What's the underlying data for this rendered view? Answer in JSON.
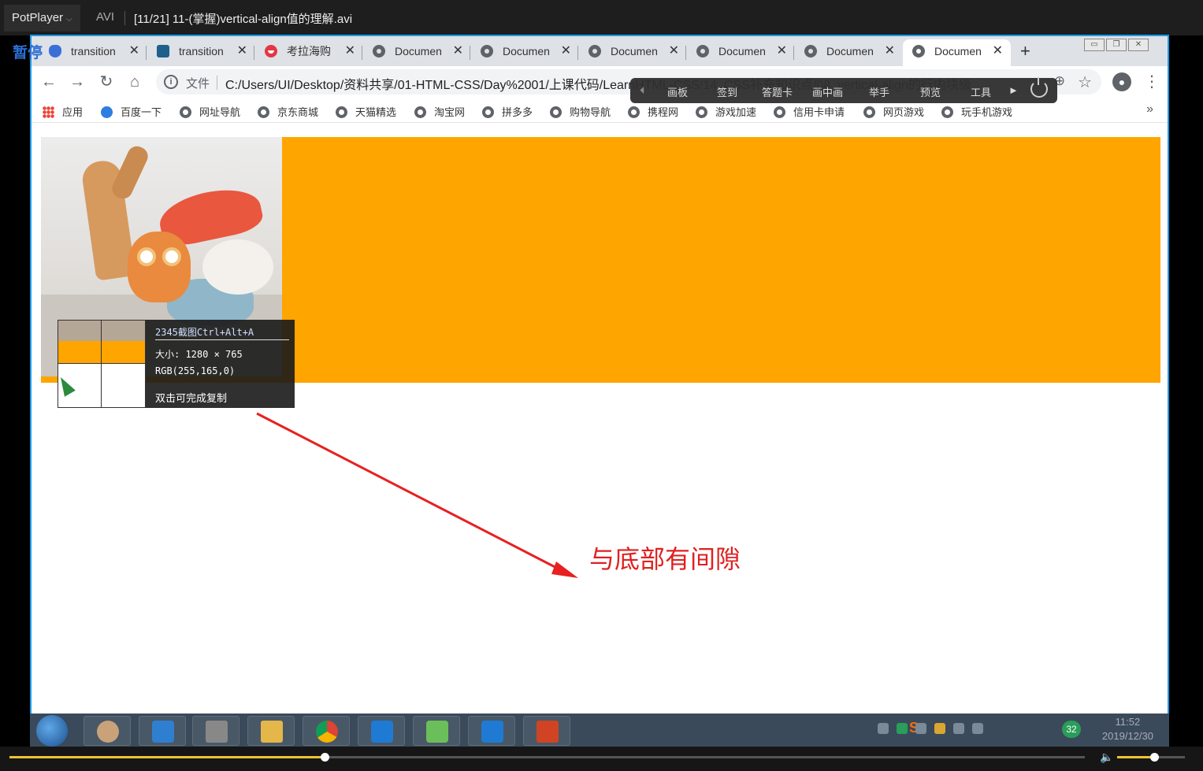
{
  "player": {
    "brand": "PotPlayer",
    "format": "AVI",
    "file_title": "[11/21] 11-(掌握)vertical-align值的理解.avi",
    "status": "暂停",
    "seek_progress": 0.293,
    "volume": 0.55
  },
  "browser": {
    "tabs": [
      {
        "label": "transition",
        "icon": "baidu-paw-icon"
      },
      {
        "label": "transition",
        "icon": "transition-site-icon"
      },
      {
        "label": "考拉海购",
        "icon": "kaola-icon"
      },
      {
        "label": "Documen",
        "icon": "globe-icon"
      },
      {
        "label": "Documen",
        "icon": "globe-icon"
      },
      {
        "label": "Documen",
        "icon": "globe-icon"
      },
      {
        "label": "Documen",
        "icon": "globe-icon"
      },
      {
        "label": "Documen",
        "icon": "globe-icon"
      },
      {
        "label": "Documen",
        "icon": "globe-icon"
      }
    ],
    "active_tab_index": 8,
    "new_tab_label": "+",
    "address": {
      "scheme_label": "文件",
      "url": "C:/Users/UI/Desktop/资料共享/01-HTML-CSS/Day%2001/上课代码/LearnHTML-CSS/14_CSS补充知识点/08_vertical-align的行内块级"
    },
    "bookmarks": [
      {
        "label": "应用",
        "icon": "apps-icon"
      },
      {
        "label": "百度一下",
        "icon": "baidu-paw-icon"
      },
      {
        "label": "网址导航",
        "icon": "globe-icon"
      },
      {
        "label": "京东商城",
        "icon": "globe-icon"
      },
      {
        "label": "天猫精选",
        "icon": "globe-icon"
      },
      {
        "label": "淘宝网",
        "icon": "globe-icon"
      },
      {
        "label": "拼多多",
        "icon": "globe-icon"
      },
      {
        "label": "购物导航",
        "icon": "globe-icon"
      },
      {
        "label": "携程网",
        "icon": "globe-icon"
      },
      {
        "label": "游戏加速",
        "icon": "globe-icon"
      },
      {
        "label": "信用卡申请",
        "icon": "globe-icon"
      },
      {
        "label": "网页游戏",
        "icon": "globe-icon"
      },
      {
        "label": "玩手机游戏",
        "icon": "globe-icon"
      }
    ],
    "bookmarks_more": "»"
  },
  "overlay_toolbar": {
    "items": [
      "画板",
      "签到",
      "答题卡",
      "画中画",
      "举手",
      "预览",
      "工具"
    ]
  },
  "page": {
    "box_color": "#ffa500",
    "screenshot_tool": {
      "title": "2345截图Ctrl+Alt+A",
      "size_text": "大小: 1280 × 765",
      "rgb_text": "RGB(255,165,0)",
      "hint": "双击可完成复制"
    },
    "annotation": {
      "text": "与底部有间隙",
      "color": "#e02020"
    }
  },
  "taskbar": {
    "tray_badge": "32",
    "sogou": "S",
    "time": "11:52",
    "date": "2019/12/30"
  }
}
